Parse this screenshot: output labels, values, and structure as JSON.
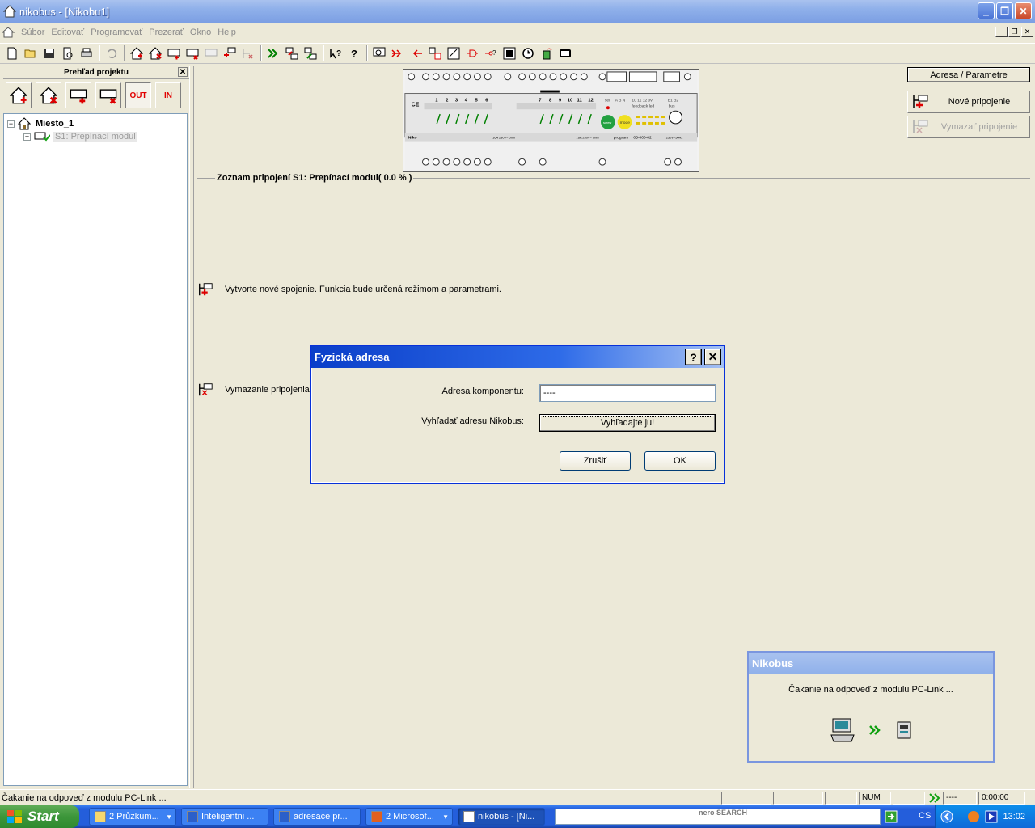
{
  "window": {
    "title": "nikobus - [Nikobu1]"
  },
  "menu": {
    "items": [
      "Súbor",
      "Editovať",
      "Programovať",
      "Prezerať",
      "Okno",
      "Help"
    ]
  },
  "left_pane": {
    "title": "Prehľad projektu",
    "tool_out": "OUT",
    "tool_in": "IN",
    "tree": {
      "root": "Miesto_1",
      "child": "S1: Prepínací modul"
    }
  },
  "main": {
    "connections_title": "Zoznam pripojení S1: Prepínací modul( 0.0 % )",
    "hint_new": "Vytvorte nové spojenie. Funkcia bude určená režimom a parametrami.",
    "hint_delete": "Vymazanie pripojenia",
    "param_button": "Adresa / Parametre",
    "new_conn_button": "Nové pripojenie",
    "delete_conn_button": "Vymazať pripojenie"
  },
  "module": {
    "top_numbers": [
      "1",
      "2",
      "3",
      "4",
      "5",
      "6",
      "7",
      "8",
      "9",
      "10",
      "11",
      "12"
    ],
    "label_sel": "sel",
    "label_abn": "A   B   N",
    "label_feedback": "10 11 12 0v",
    "label_feedback_led": "feedback led",
    "label_bus": "bus",
    "label_b1b2": "B1 B2",
    "btn_green": "screw",
    "btn_yellow": "mode",
    "label_program": "program",
    "code": "05-000-02",
    "voltage": "230V~50Hz",
    "spec": "16A 230V~ ohm",
    "brand": "Niko"
  },
  "dialog": {
    "title": "Fyzická adresa",
    "help": "?",
    "address_label": "Adresa komponentu:",
    "address_value": "----",
    "search_label": "Vyhľadať adresu Nikobus:",
    "search_button": "Vyhľadajte ju!",
    "cancel_button": "Zrušiť",
    "ok_button": "OK"
  },
  "wait_dialog": {
    "title": "Nikobus",
    "message": "Čakanie na odpoveď z modulu PC-Link ..."
  },
  "status_bar": {
    "message": "Čakanie na odpoveď z modulu PC-Link ...",
    "num": "NUM",
    "address": "----",
    "time": "0:00:00"
  },
  "taskbar": {
    "start": "Start",
    "tasks": [
      "2 Průzkum...",
      "Inteligentni ...",
      "adresace pr...",
      "2 Microsof...",
      "nikobus - [Ni..."
    ],
    "nero_label": "nero SEARCH",
    "language": "CS",
    "clock": "13:02"
  }
}
